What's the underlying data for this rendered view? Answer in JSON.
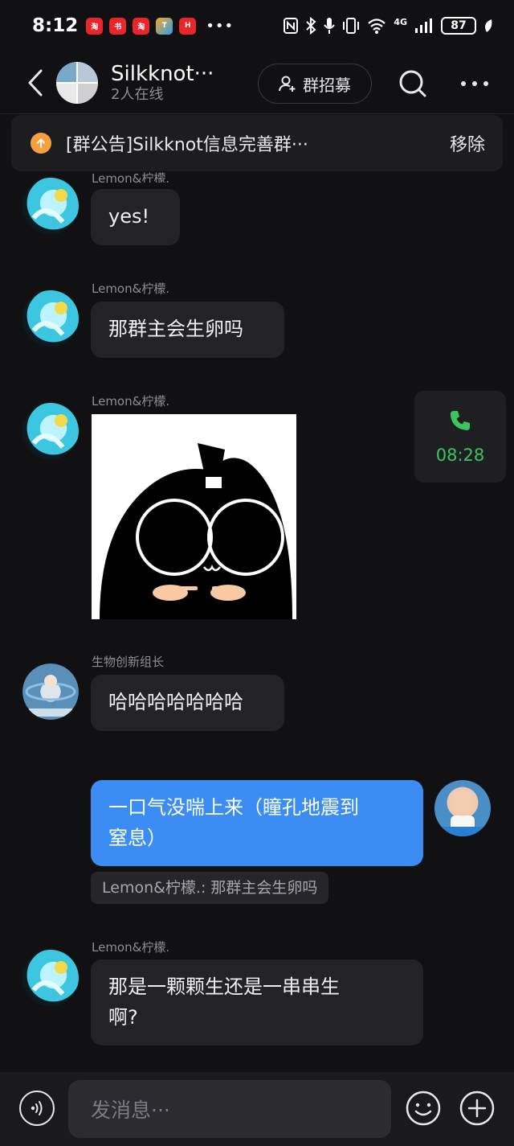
{
  "status_bar": {
    "time": "8:12",
    "battery": "87",
    "network": "4G"
  },
  "header": {
    "title": "Silkknot···",
    "online": "2人在线",
    "recruit_label": "群招募"
  },
  "notice": {
    "text": "[群公告]Silkknot信息完善群···",
    "remove_label": "移除"
  },
  "messages": [
    {
      "sender": "Lemon&柠檬.",
      "text": "yes!"
    },
    {
      "sender": "Lemon&柠檬.",
      "text": "那群主会生卵吗"
    },
    {
      "sender": "Lemon&柠檬.",
      "type": "sticker"
    },
    {
      "sender": "生物创新组长",
      "text": "哈哈哈哈哈哈哈"
    },
    {
      "sender": "me",
      "line1": "一口气没喘上来（瞳孔地震到",
      "line2": "窒息）",
      "quote": "Lemon&柠檬.: 那群主会生卵吗"
    },
    {
      "sender": "Lemon&柠檬.",
      "line1": "那是一颗颗生还是一串串生",
      "line2": "啊?"
    }
  ],
  "call": {
    "duration": "08:28"
  },
  "input": {
    "placeholder": "发消息···"
  },
  "colors": {
    "background": "#111113",
    "bubble": "#232327",
    "my_bubble": "#3b8cf3",
    "call_green": "#3cc45f",
    "notice_icon": "#f7a13c"
  }
}
